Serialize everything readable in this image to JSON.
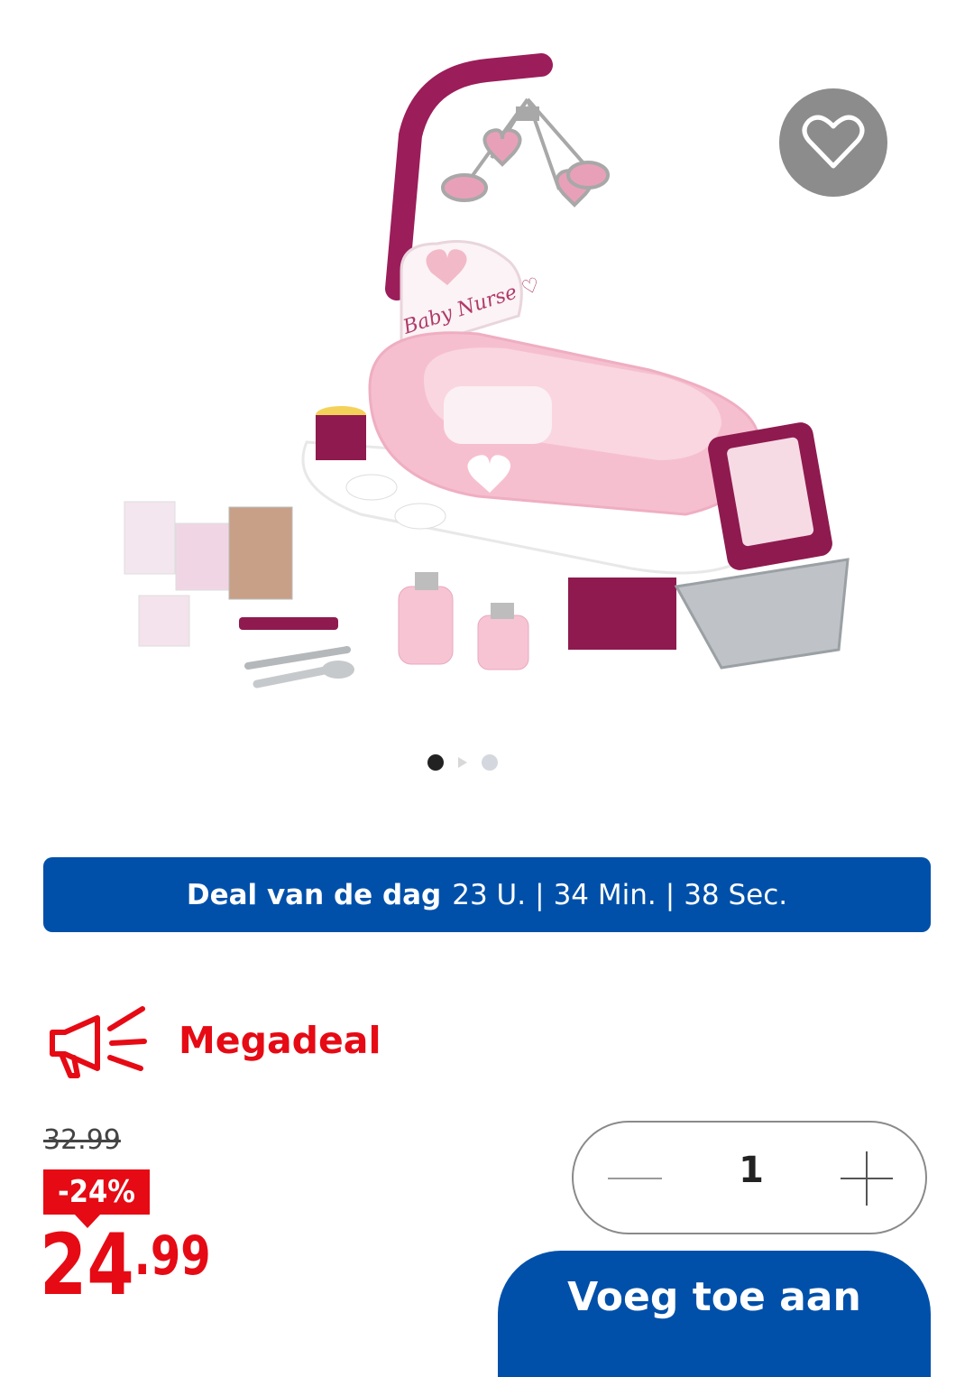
{
  "product": {
    "image_alt": "product-image",
    "favorite_icon": "heart-outline-icon",
    "brand_text": "Baby Nurse"
  },
  "carousel": {
    "count": 3,
    "active_index": 0
  },
  "deal": {
    "label": "Deal van de dag",
    "hours": "23 U.",
    "sep1": "|",
    "minutes": "34 Min.",
    "sep2": "|",
    "seconds": "38 Sec."
  },
  "promo": {
    "icon": "megaphone-icon",
    "label": "Megadeal"
  },
  "pricing": {
    "old_price": "32.99",
    "discount": "-24%",
    "price_int": "24",
    "price_dec": ".99"
  },
  "quantity": {
    "value": "1",
    "minus_icon": "minus-icon",
    "plus_icon": "plus-icon"
  },
  "cart": {
    "add_label": "Voeg toe aan"
  },
  "colors": {
    "accent_blue": "#0050aa",
    "deal_red": "#e60a14"
  }
}
